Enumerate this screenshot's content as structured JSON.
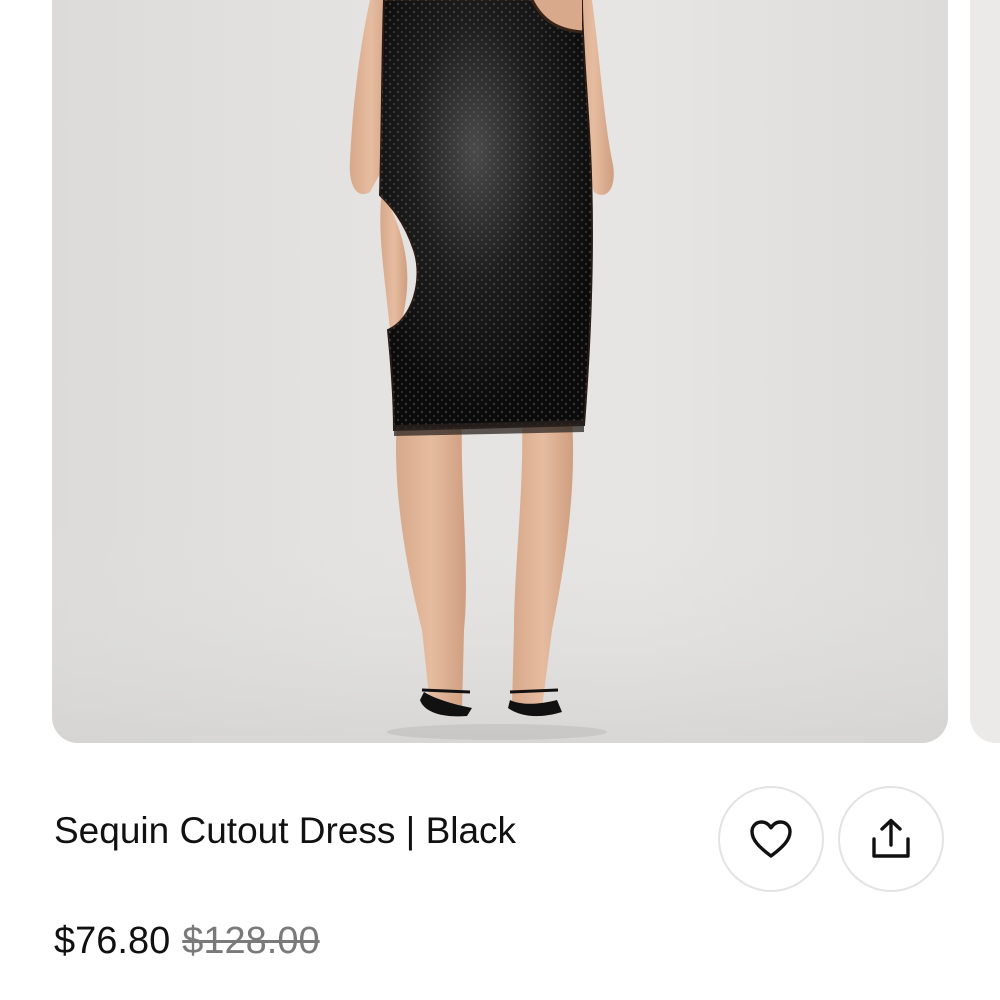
{
  "product": {
    "title": "Sequin Cutout Dress | Black",
    "price_current": "$76.80",
    "price_original": "$128.00"
  },
  "actions": {
    "favorite_icon": "heart-icon",
    "share_icon": "share-icon"
  },
  "colors": {
    "text": "#111111",
    "strikethrough_price": "#7a7a7a",
    "image_background": "#e4e3e1",
    "dress": "#151515"
  }
}
